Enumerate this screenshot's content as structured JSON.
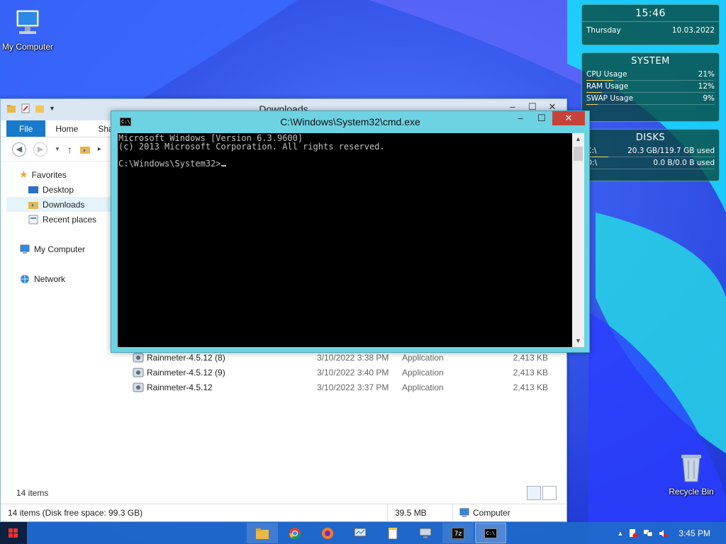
{
  "desktop": {
    "icons": [
      {
        "label": "My Computer",
        "icon": "computer-icon"
      },
      {
        "label": "Recycle Bin",
        "icon": "recycle-bin-icon"
      }
    ]
  },
  "widgets": {
    "clock": {
      "time": "15:46",
      "day": "Thursday",
      "date": "10.03.2022"
    },
    "system": {
      "title": "SYSTEM",
      "rows": [
        {
          "label": "CPU Usage",
          "value": "21%",
          "level": 0.21
        },
        {
          "label": "RAM Usage",
          "value": "12%",
          "level": 0.12
        },
        {
          "label": "SWAP Usage",
          "value": "9%",
          "level": 0.09
        }
      ]
    },
    "disks": {
      "title": "DISKS",
      "rows": [
        {
          "label": "C:\\",
          "value": "20.3 GB/119.7 GB used",
          "level": 0.17
        },
        {
          "label": "D:\\",
          "value": "0.0 B/0.0 B used",
          "level": 0
        }
      ]
    }
  },
  "explorer": {
    "title": "Downloads",
    "tabs": [
      "File",
      "Home",
      "Sha"
    ],
    "nav": {
      "favorites": "Favorites",
      "desktop": "Desktop",
      "downloads": "Downloads",
      "recent": "Recent places",
      "computer": "My Computer",
      "network": "Network"
    },
    "files": [
      {
        "name": "Rainmeter-4.5.12 (8)",
        "date": "3/10/2022 3:38 PM",
        "type": "Application",
        "size": "2,413 KB"
      },
      {
        "name": "Rainmeter-4.5.12 (9)",
        "date": "3/10/2022 3:40 PM",
        "type": "Application",
        "size": "2,413 KB"
      },
      {
        "name": "Rainmeter-4.5.12",
        "date": "3/10/2022 3:37 PM",
        "type": "Application",
        "size": "2,413 KB"
      }
    ],
    "item_count": "14 items",
    "status": {
      "left": "14 items (Disk free space: 99.3 GB)",
      "size": "39.5 MB",
      "location": "Computer"
    }
  },
  "cmd": {
    "title": "C:\\Windows\\System32\\cmd.exe",
    "lines": [
      "Microsoft Windows [Version 6.3.9600]",
      "(c) 2013 Microsoft Corporation. All rights reserved.",
      "",
      "C:\\Windows\\System32>"
    ]
  },
  "taskbar": {
    "clock": "3:45 PM",
    "apps": [
      "file-explorer-icon",
      "chrome-icon",
      "firefox-icon",
      "monitor-icon",
      "notepad-icon",
      "remote-icon",
      "7zip-icon",
      "cmd-icon"
    ]
  },
  "colors": {
    "accent": "#1979ca",
    "cmd_frame": "#6dd3e2",
    "close": "#c7433a"
  }
}
